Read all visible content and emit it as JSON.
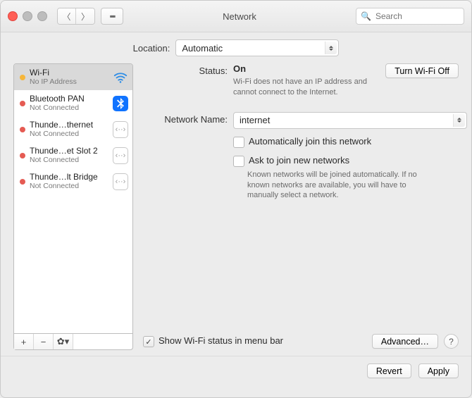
{
  "window": {
    "title": "Network"
  },
  "search": {
    "placeholder": "Search"
  },
  "location": {
    "label": "Location:",
    "value": "Automatic"
  },
  "sidebar": {
    "items": [
      {
        "name": "Wi-Fi",
        "sub": "No IP Address",
        "status": "yellow",
        "icon": "wifi",
        "selected": true
      },
      {
        "name": "Bluetooth PAN",
        "sub": "Not Connected",
        "status": "red",
        "icon": "bluetooth",
        "selected": false
      },
      {
        "name": "Thunde…thernet",
        "sub": "Not Connected",
        "status": "red",
        "icon": "thunderbolt",
        "selected": false
      },
      {
        "name": "Thunde…et Slot 2",
        "sub": "Not Connected",
        "status": "red",
        "icon": "thunderbolt",
        "selected": false
      },
      {
        "name": "Thunde…lt Bridge",
        "sub": "Not Connected",
        "status": "red",
        "icon": "thunderbolt",
        "selected": false
      }
    ]
  },
  "detail": {
    "status_label": "Status:",
    "status_value": "On",
    "turn_off": "Turn Wi-Fi Off",
    "status_hint": "Wi-Fi does not have an IP address and cannot connect to the Internet.",
    "network_label": "Network Name:",
    "network_value": "internet",
    "auto_join": "Automatically join this network",
    "ask_join": "Ask to join new networks",
    "ask_hint": "Known networks will be joined automatically. If no known networks are available, you will have to manually select a network.",
    "show_menubar": "Show Wi-Fi status in menu bar",
    "advanced": "Advanced…"
  },
  "footer": {
    "revert": "Revert",
    "apply": "Apply"
  }
}
